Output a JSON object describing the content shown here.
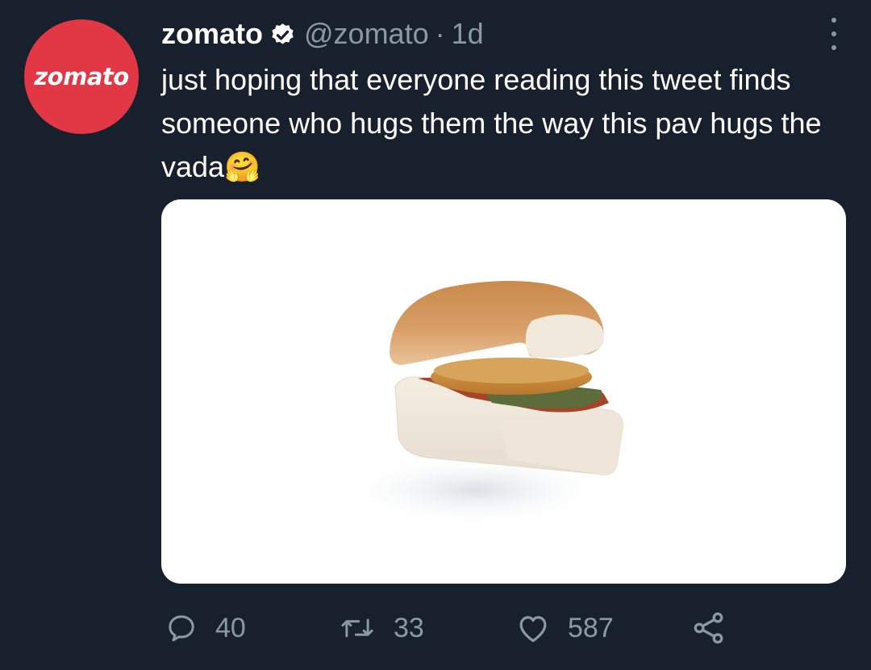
{
  "tweet": {
    "avatar_text": "zomato",
    "display_name": "zomato",
    "handle": "@zomato",
    "separator": "·",
    "time": "1d",
    "text": "just hoping that everyone reading this tweet finds someone who hugs them the way this pav hugs the vada",
    "emoji": "🤗",
    "media_description": "vada pav"
  },
  "actions": {
    "replies": "40",
    "retweets": "33",
    "likes": "587"
  },
  "icons": {
    "verified": "verified-badge-icon",
    "more": "more-options-icon",
    "reply": "reply-icon",
    "retweet": "retweet-icon",
    "like": "heart-icon",
    "share": "share-icon"
  },
  "colors": {
    "background": "#18202d",
    "brand": "#e23744",
    "muted": "#8b98a5"
  }
}
